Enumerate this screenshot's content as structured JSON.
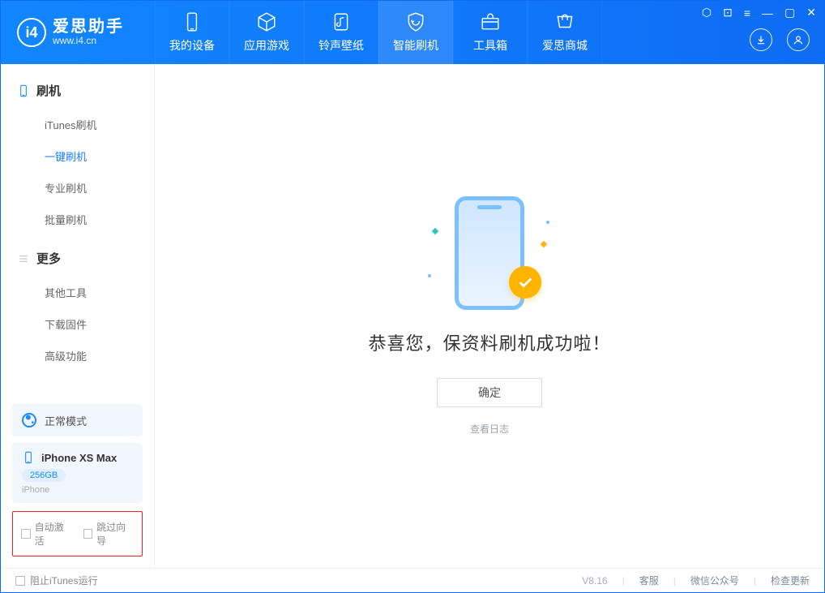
{
  "app": {
    "name": "爱思助手",
    "site": "www.i4.cn",
    "logo_letter": "i4"
  },
  "nav": {
    "items": [
      {
        "label": "我的设备",
        "icon": "device-icon"
      },
      {
        "label": "应用游戏",
        "icon": "cube-icon"
      },
      {
        "label": "铃声壁纸",
        "icon": "note-icon"
      },
      {
        "label": "智能刷机",
        "icon": "refresh-shield-icon",
        "active": true
      },
      {
        "label": "工具箱",
        "icon": "toolbox-icon"
      },
      {
        "label": "爱思商城",
        "icon": "cart-icon"
      }
    ]
  },
  "sidebar": {
    "section_flash": {
      "title": "刷机",
      "items": [
        {
          "label": "iTunes刷机"
        },
        {
          "label": "一键刷机",
          "active": true
        },
        {
          "label": "专业刷机"
        },
        {
          "label": "批量刷机"
        }
      ]
    },
    "section_more": {
      "title": "更多",
      "items": [
        {
          "label": "其他工具"
        },
        {
          "label": "下载固件"
        },
        {
          "label": "高级功能"
        }
      ]
    },
    "mode": {
      "label": "正常模式"
    },
    "device": {
      "name": "iPhone XS Max",
      "storage": "256GB",
      "system": "iPhone"
    },
    "options": {
      "auto_activate": "自动激活",
      "skip_guide": "跳过向导"
    }
  },
  "main": {
    "success_text": "恭喜您，保资料刷机成功啦！",
    "ok_button": "确定",
    "view_log": "查看日志"
  },
  "statusbar": {
    "block_itunes": "阻止iTunes运行",
    "version": "V8.16",
    "links": {
      "support": "客服",
      "wechat": "微信公众号",
      "update": "检查更新"
    }
  }
}
